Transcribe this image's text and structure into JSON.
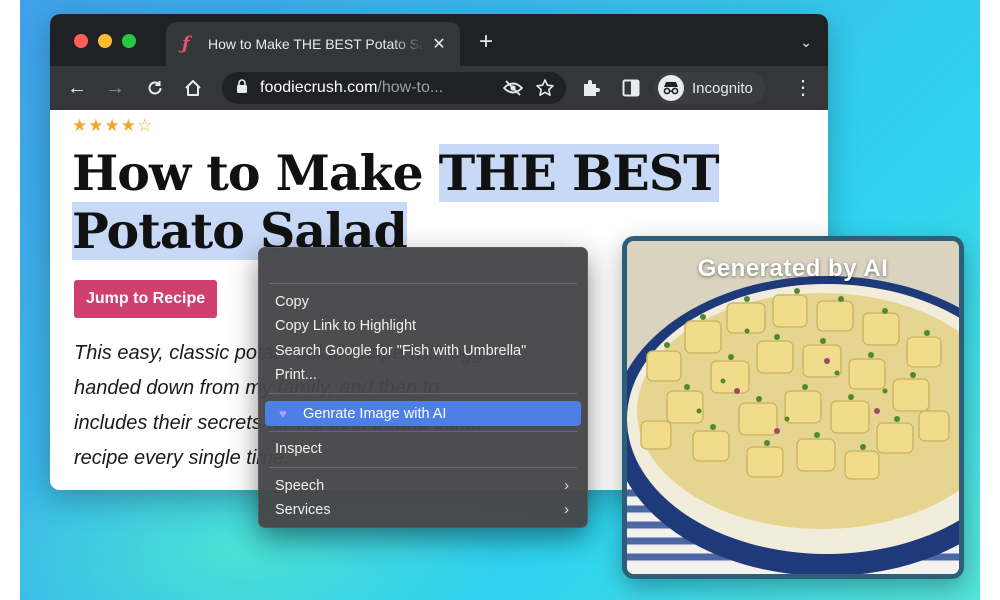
{
  "browser": {
    "tab": {
      "title": "How to Make THE BEST Potato Salad",
      "close_glyph": "✕"
    },
    "new_tab_glyph": "+",
    "tab_search_glyph": "⌄",
    "toolbar": {
      "back_glyph": "←",
      "forward_glyph": "→",
      "reload_glyph": "C",
      "home_glyph": "⌂",
      "url_domain": "foodiecrush.com",
      "url_path": "/how-to...",
      "incognito_label": "Incognito",
      "menu_glyph": "⋮"
    }
  },
  "page": {
    "rating_stars": "★★★★☆",
    "headline": {
      "line1_plain": "How to Make ",
      "line1_highlight": "THE BEST",
      "line2_highlight": "Potato Salad"
    },
    "jump_button": "Jump to Recipe",
    "intro_lines": [
      "This easy, classic potato salad recipe with eggs",
      "handed down from my family, and then to",
      "includes their secrets for the best potato salad",
      "recipe every single time."
    ]
  },
  "context_menu": {
    "items": [
      {
        "label": "Copy"
      },
      {
        "label": "Copy Link to Highlight"
      },
      {
        "label": "Search Google for \"Fish with Umbrella\""
      },
      {
        "label": "Print..."
      }
    ],
    "ai_item": "Genrate Image with AI",
    "inspect": "Inspect",
    "speech": "Speech",
    "services": "Services",
    "submenu_glyph": "›"
  },
  "generated_card": {
    "label": "Generated by AI"
  },
  "colors": {
    "highlight": "#c7d9f7",
    "jump_button": "#d0406e",
    "menu_selected": "#4d7fe6",
    "star": "#f4a62a",
    "card_border": "#2e5f78"
  }
}
